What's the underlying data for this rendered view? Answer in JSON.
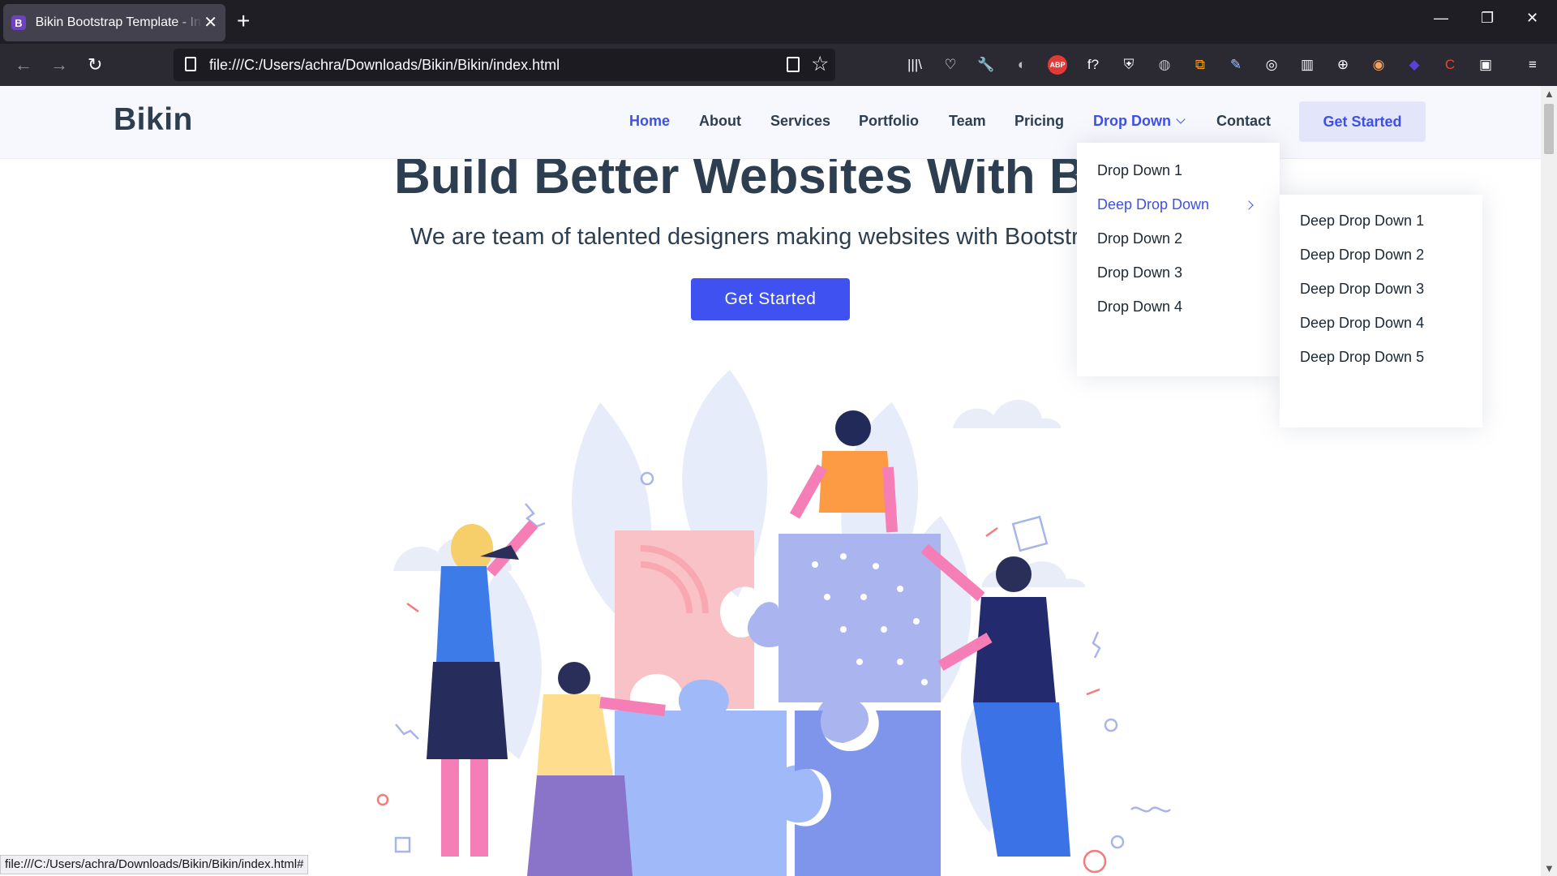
{
  "browser": {
    "tab_title": "Bikin Bootstrap Template - Index",
    "tab_favicon": "B",
    "tab_close": "✕",
    "new_tab": "+",
    "url": "file:///C:/Users/achra/Downloads/Bikin/Bikin/index.html",
    "status_url": "file:///C:/Users/achra/Downloads/Bikin/Bikin/index.html#",
    "nav_back": "←",
    "nav_forward": "→",
    "nav_reload": "↻",
    "win_minimize": "—",
    "win_restore": "❐",
    "win_close": "✕",
    "extensions": [
      {
        "icon": "library-icon",
        "glyph": "|||\\"
      },
      {
        "icon": "pocket-icon",
        "glyph": "♡"
      },
      {
        "icon": "wrench-icon",
        "glyph": "🔧"
      },
      {
        "icon": "globe-shield-icon",
        "glyph": "◐"
      },
      {
        "icon": "adblock-plus-icon",
        "glyph": "ABP"
      },
      {
        "icon": "function-icon",
        "glyph": "f?"
      },
      {
        "icon": "privacy-shield-icon",
        "glyph": "⛨"
      },
      {
        "icon": "world-icon",
        "glyph": "◍"
      },
      {
        "icon": "copy-icon",
        "glyph": "⧉"
      },
      {
        "icon": "pen-icon",
        "glyph": "✎"
      },
      {
        "icon": "instagram-icon",
        "glyph": "◎"
      },
      {
        "icon": "grid-icon",
        "glyph": "▥"
      },
      {
        "icon": "translate-icon",
        "glyph": "⊕"
      },
      {
        "icon": "mask-icon",
        "glyph": "◉"
      },
      {
        "icon": "diamond-icon",
        "glyph": "◆"
      },
      {
        "icon": "c-extension-icon",
        "glyph": "C"
      },
      {
        "icon": "screenshot-icon",
        "glyph": "▣"
      },
      {
        "icon": "hamburger-menu-icon",
        "glyph": "≡"
      }
    ]
  },
  "site": {
    "logo": "Bikin",
    "menu": [
      {
        "label": "Home",
        "active": true
      },
      {
        "label": "About"
      },
      {
        "label": "Services"
      },
      {
        "label": "Portfolio"
      },
      {
        "label": "Team"
      },
      {
        "label": "Pricing"
      },
      {
        "label": "Drop Down",
        "active": true
      },
      {
        "label": "Contact"
      }
    ],
    "header_cta": "Get Started",
    "dropdown": [
      {
        "label": "Drop Down 1"
      },
      {
        "label": "Deep Drop Down",
        "active": true
      },
      {
        "label": "Drop Down 2"
      },
      {
        "label": "Drop Down 3"
      },
      {
        "label": "Drop Down 4"
      }
    ],
    "subdropdown": [
      {
        "label": "Deep Drop Down 1"
      },
      {
        "label": "Deep Drop Down 2"
      },
      {
        "label": "Deep Drop Down 3"
      },
      {
        "label": "Deep Drop Down 4"
      },
      {
        "label": "Deep Drop Down 5"
      }
    ]
  },
  "hero": {
    "title": "Build Better Websites With Bikin",
    "subtitle": "We are team of talented designers making websites with Bootstrap",
    "cta": "Get Started"
  },
  "colors": {
    "accent": "#3f51e5",
    "heading": "#2c3e50",
    "chrome_dark": "#1f1e25"
  }
}
